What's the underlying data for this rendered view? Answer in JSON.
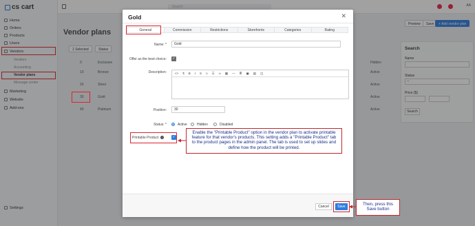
{
  "app": {
    "logo_text": "cs cart"
  },
  "sidebar": {
    "items": [
      {
        "label": "Home"
      },
      {
        "label": "Orders"
      },
      {
        "label": "Products"
      },
      {
        "label": "Users"
      },
      {
        "label": "Vendors"
      }
    ],
    "vendor_sub": [
      {
        "label": "Vendors"
      },
      {
        "label": "Accounting"
      },
      {
        "label": "Vendor plans"
      },
      {
        "label": "Message center"
      }
    ],
    "items2": [
      {
        "label": "Marketing"
      },
      {
        "label": "Website"
      },
      {
        "label": "Add-ons"
      }
    ],
    "settings": "Settings"
  },
  "topbar": {
    "search_placeholder": "Search"
  },
  "page": {
    "title": "Vendor plans",
    "preview": "Preview",
    "save": "Save",
    "add": "+ Add vendor plan",
    "selected": "1 Selected",
    "status": "Status"
  },
  "table": {
    "rows": [
      {
        "pos": "0",
        "name": "Exclusive",
        "status": "Hidden"
      },
      {
        "pos": "10",
        "name": "Bronze",
        "status": "Active"
      },
      {
        "pos": "20",
        "name": "Silver",
        "status": "Active"
      },
      {
        "pos": "30",
        "name": "Gold",
        "status": "Active"
      },
      {
        "pos": "40",
        "name": "Platinum",
        "status": "Active"
      }
    ]
  },
  "search_panel": {
    "title": "Search",
    "name_label": "Name",
    "status_label": "Status",
    "status_value": "--",
    "price_label": "Price ($)",
    "button": "Search"
  },
  "modal": {
    "title": "Gold",
    "tabs": [
      {
        "label": "General"
      },
      {
        "label": "Commission"
      },
      {
        "label": "Restrictions"
      },
      {
        "label": "Storefronts"
      },
      {
        "label": "Categories"
      },
      {
        "label": "Rating"
      }
    ],
    "name_label": "Name: *",
    "name_value": "Gold",
    "best_choice_label": "Offer as the best choice:",
    "description_label": "Description:",
    "position_label": "Position:",
    "position_value": "30",
    "status_label": "Status: *",
    "status_options": [
      {
        "label": "Active"
      },
      {
        "label": "Hidden"
      },
      {
        "label": "Disabled"
      }
    ],
    "printable_label": "Printable Product",
    "cancel": "Cancel",
    "save": "Save"
  },
  "callouts": {
    "printable": "Enable the \"Printable Product\" option in the vendor plan to activate printable feature for that vendor's products. This setting adds a \"Printable Product\" tab to the product pages in the admin panel. The tab is used to set up slides and define how the product will be printed.",
    "save": "Then, press this Save button"
  },
  "colors": {
    "accent": "#2f7ddf",
    "annotation_red": "#c0272d",
    "annotation_text": "#1a2e8a"
  }
}
